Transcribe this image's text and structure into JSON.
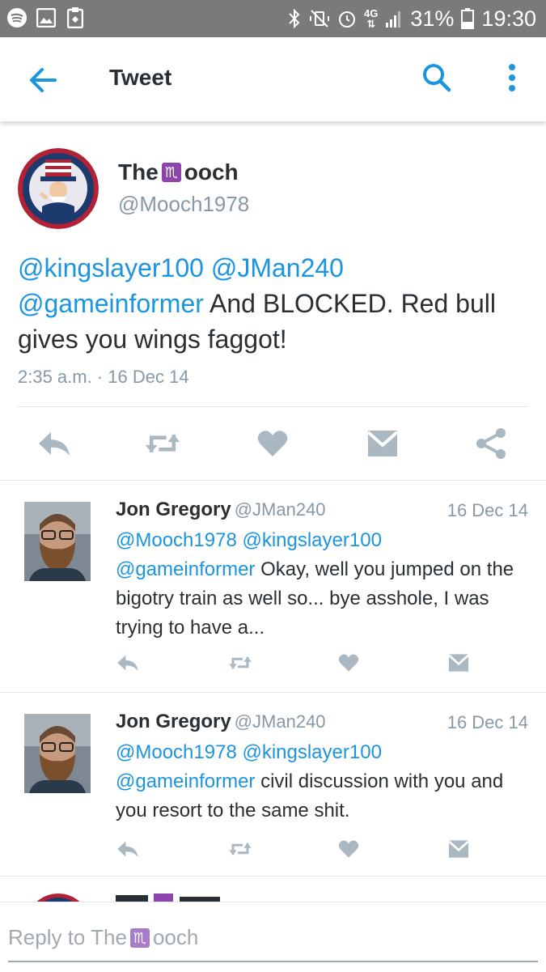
{
  "status_bar": {
    "left_icons": [
      "spotify-icon",
      "image-icon",
      "clipboard-icon"
    ],
    "right_icons": [
      "bluetooth-icon",
      "mute-icon",
      "alarm-icon",
      "4g-icon",
      "signal-icon"
    ],
    "battery": "31%",
    "time": "19:30"
  },
  "app_bar": {
    "title": "Tweet"
  },
  "tweet": {
    "name_pre": "The",
    "name_glyph": "♏",
    "name_post": "ooch",
    "handle": "@Mooch1978",
    "mentions": "@kingslayer100 @JMan240",
    "mention2": "@gameinformer",
    "text": " And BLOCKED. Red bull gives you wings faggot!",
    "time": "2:35 a.m. · 16 Dec 14"
  },
  "replies": [
    {
      "name": "Jon Gregory",
      "handle": "@JMan240",
      "date": "16 Dec 14",
      "mentions1": "@Mooch1978 @kingslayer100",
      "mentions2": "@gameinformer",
      "text": " Okay, well you jumped on the bigotry train as well so... bye asshole, I was trying to have a..."
    },
    {
      "name": "Jon Gregory",
      "handle": "@JMan240",
      "date": "16 Dec 14",
      "mentions1": "@Mooch1978 @kingslayer100",
      "mentions2": "@gameinformer",
      "text": " civil discussion with you and you resort to the same shit."
    }
  ],
  "reply_bar": {
    "pre": "Reply to The",
    "glyph": "♏",
    "post": "ooch"
  },
  "colors": {
    "accent": "#1b95e0",
    "text": "#292f33",
    "muted": "#8899a6",
    "icon": "#aab8c2",
    "status_bg": "#7a7a7a"
  }
}
